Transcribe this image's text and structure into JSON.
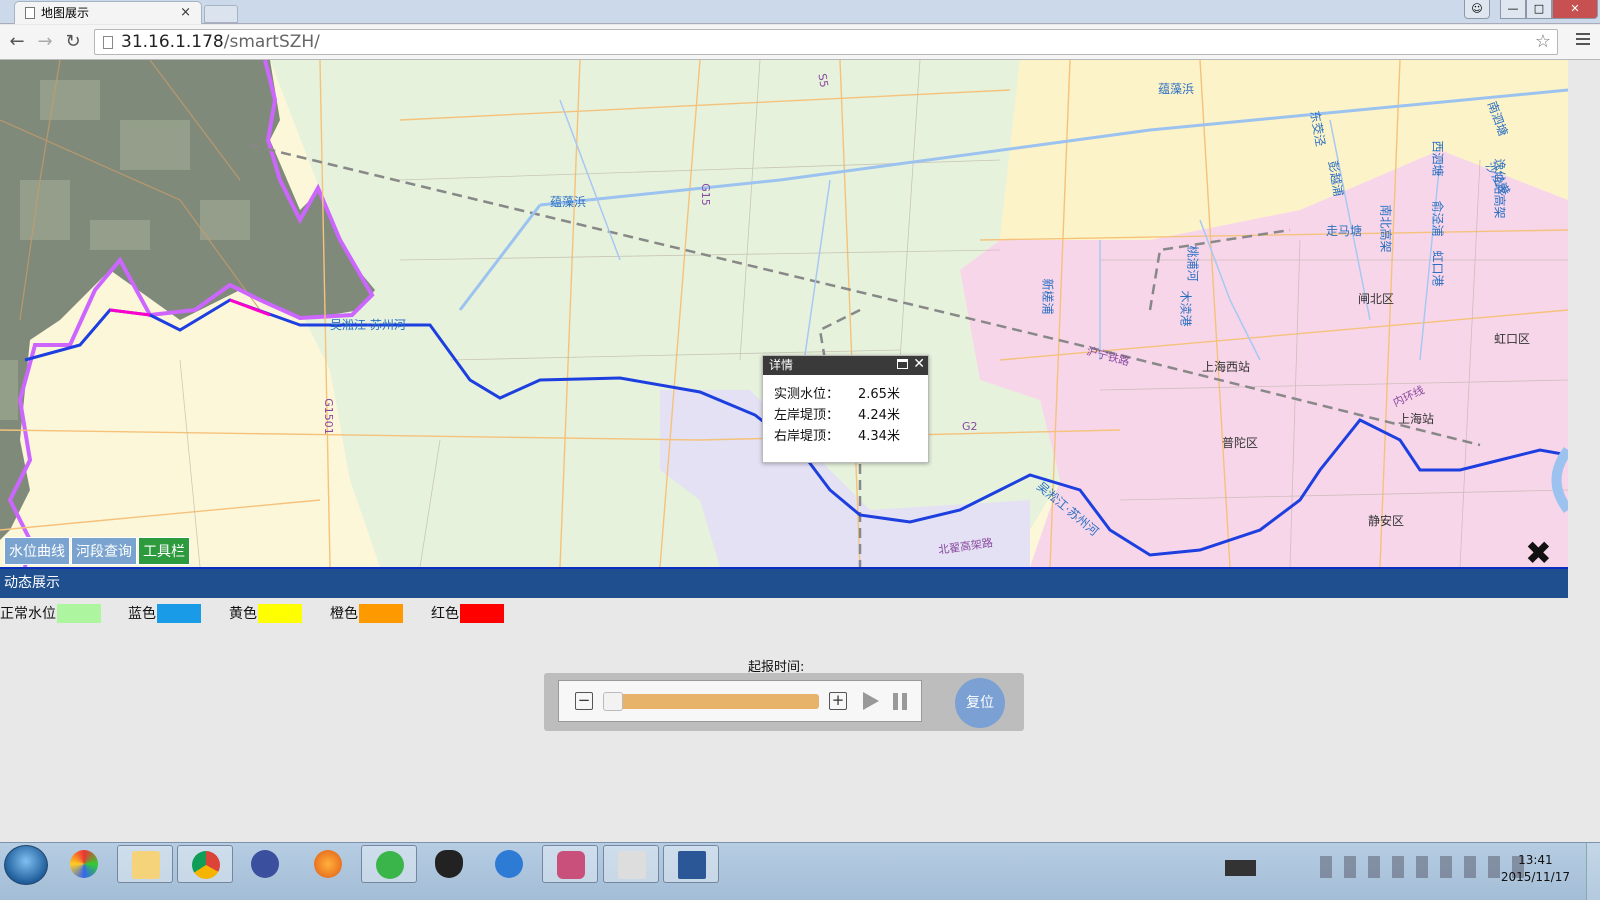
{
  "browser": {
    "tab_title": "地图展示",
    "tab_close": "×",
    "url_host": "31.16.1.178",
    "url_path": "/smartSZH/",
    "star": "☆"
  },
  "map": {
    "place_labels": [
      "闸北区",
      "虹口区",
      "普陀区",
      "静安区",
      "上海西站",
      "上海站"
    ],
    "river_labels": [
      "蕴藻浜",
      "蕴藻浜",
      "吴淞江·苏州河",
      "吴淞江·苏州河",
      "新槎浦",
      "桃浦河",
      "木渎港",
      "走马塘",
      "东茭泾",
      "彭越浦",
      "南北高架",
      "西泗塘",
      "俞泾浦",
      "虹口港",
      "沙泾港",
      "南泗塘",
      "逸仙路高架",
      "沪宁铁路",
      "内环线",
      "北翟高架路"
    ],
    "highway_labels": [
      "G15",
      "G1501",
      "G2",
      "S5"
    ],
    "popup": {
      "title": "详情",
      "rows": [
        {
          "key": "实测水位：",
          "value": "2.65米"
        },
        {
          "key": "左岸堤顶：",
          "value": "4.24米"
        },
        {
          "key": "右岸堤顶：",
          "value": "4.34米"
        }
      ]
    },
    "tabs": [
      "水位曲线",
      "河段查询",
      "工具栏"
    ],
    "active_tab": "工具栏",
    "close_glyph": "✖"
  },
  "panel": {
    "title": "动态展示",
    "legend": [
      {
        "label": "正常水位",
        "color": "#aef5a0"
      },
      {
        "label": "蓝色",
        "color": "#1a9be8"
      },
      {
        "label": "黄色",
        "color": "#ffff00"
      },
      {
        "label": "橙色",
        "color": "#ff9900"
      },
      {
        "label": "红色",
        "color": "#ff0000"
      }
    ],
    "time_label": "起报时间:",
    "minus": "−",
    "plus": "+",
    "slider_position": 0,
    "reset_label": "复位"
  },
  "taskbar": {
    "clock_time": "13:41",
    "clock_date": "2015/11/17",
    "apps": [
      "windows-explorer",
      "chrome",
      "app-infinity",
      "firefox",
      "ie-green",
      "qq",
      "sogou",
      "database",
      "image",
      "word"
    ]
  }
}
